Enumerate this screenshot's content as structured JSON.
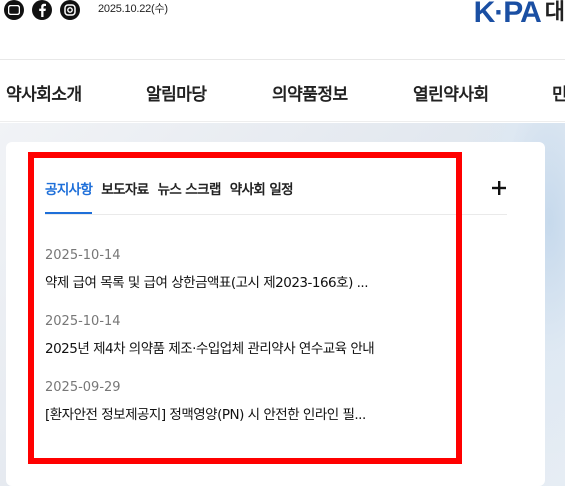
{
  "header": {
    "date": "2025.10.22(수)",
    "social_icons": [
      "youtube-icon",
      "facebook-icon",
      "instagram-icon"
    ],
    "logo_text": "K·PA",
    "logo_suffix": "대"
  },
  "nav": {
    "items": [
      {
        "label": "약사회소개"
      },
      {
        "label": "알림마당"
      },
      {
        "label": "의약품정보"
      },
      {
        "label": "열린약사회"
      },
      {
        "label": "민"
      }
    ]
  },
  "board": {
    "tabs": [
      {
        "label": "공지사항",
        "active": true
      },
      {
        "label": "보도자료",
        "active": false
      },
      {
        "label": "뉴스 스크랩",
        "active": false
      },
      {
        "label": "약사회 일정",
        "active": false
      }
    ],
    "more_icon": "plus-icon",
    "posts": [
      {
        "date": "2025-10-14",
        "title": "약제 급여 목록 및 급여 상한금액표(고시 제2023-166호) ..."
      },
      {
        "date": "2025-10-14",
        "title": "2025년 제4차 의약품 제조·수입업체 관리약사 연수교육 안내"
      },
      {
        "date": "2025-09-29",
        "title": "[환자안전 정보제공지] 정맥영양(PN) 시 안전한 인라인 필..."
      }
    ]
  },
  "colors": {
    "accent": "#1e6fd9",
    "logo_blue": "#1a4fa3",
    "highlight_box": "#ff0000"
  }
}
